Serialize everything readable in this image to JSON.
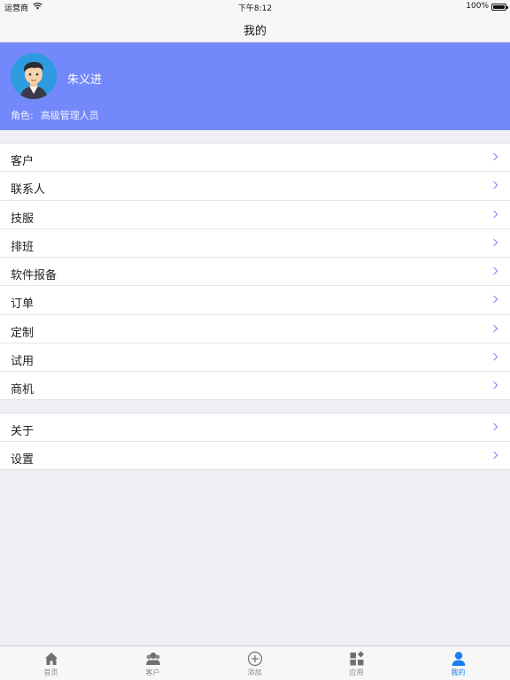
{
  "status_bar": {
    "carrier": "运营商",
    "time": "下午8:12",
    "battery": "100%"
  },
  "nav": {
    "title": "我的"
  },
  "profile": {
    "name": "朱义进",
    "role_label": "角色:",
    "role_value": "高级管理人员"
  },
  "menu_group_1": [
    {
      "label": "客户",
      "icon": "chevron-right-icon"
    },
    {
      "label": "联系人",
      "icon": "chevron-right-icon"
    },
    {
      "label": "技服",
      "icon": "chevron-right-icon"
    },
    {
      "label": "排班",
      "icon": "chevron-right-icon"
    },
    {
      "label": "软件报备",
      "icon": "chevron-right-icon"
    },
    {
      "label": "订单",
      "icon": "chevron-right-icon"
    },
    {
      "label": "定制",
      "icon": "chevron-right-icon"
    },
    {
      "label": "试用",
      "icon": "chevron-right-icon"
    },
    {
      "label": "商机",
      "icon": "chevron-right-icon"
    }
  ],
  "menu_group_2": [
    {
      "label": "关于",
      "icon": "chevron-right-icon"
    },
    {
      "label": "设置",
      "icon": "chevron-right-icon"
    }
  ],
  "tab_bar": {
    "active": "我的",
    "tabs": [
      {
        "label": "首页",
        "icon": "home-icon"
      },
      {
        "label": "客户",
        "icon": "customers-icon"
      },
      {
        "label": "添加",
        "icon": "add-circle-icon"
      },
      {
        "label": "应用",
        "icon": "apps-icon"
      },
      {
        "label": "我的",
        "icon": "person-icon"
      }
    ]
  },
  "colors": {
    "accent": "#7389fb",
    "tab_active": "#1a7ef2",
    "background": "#efeff4"
  }
}
